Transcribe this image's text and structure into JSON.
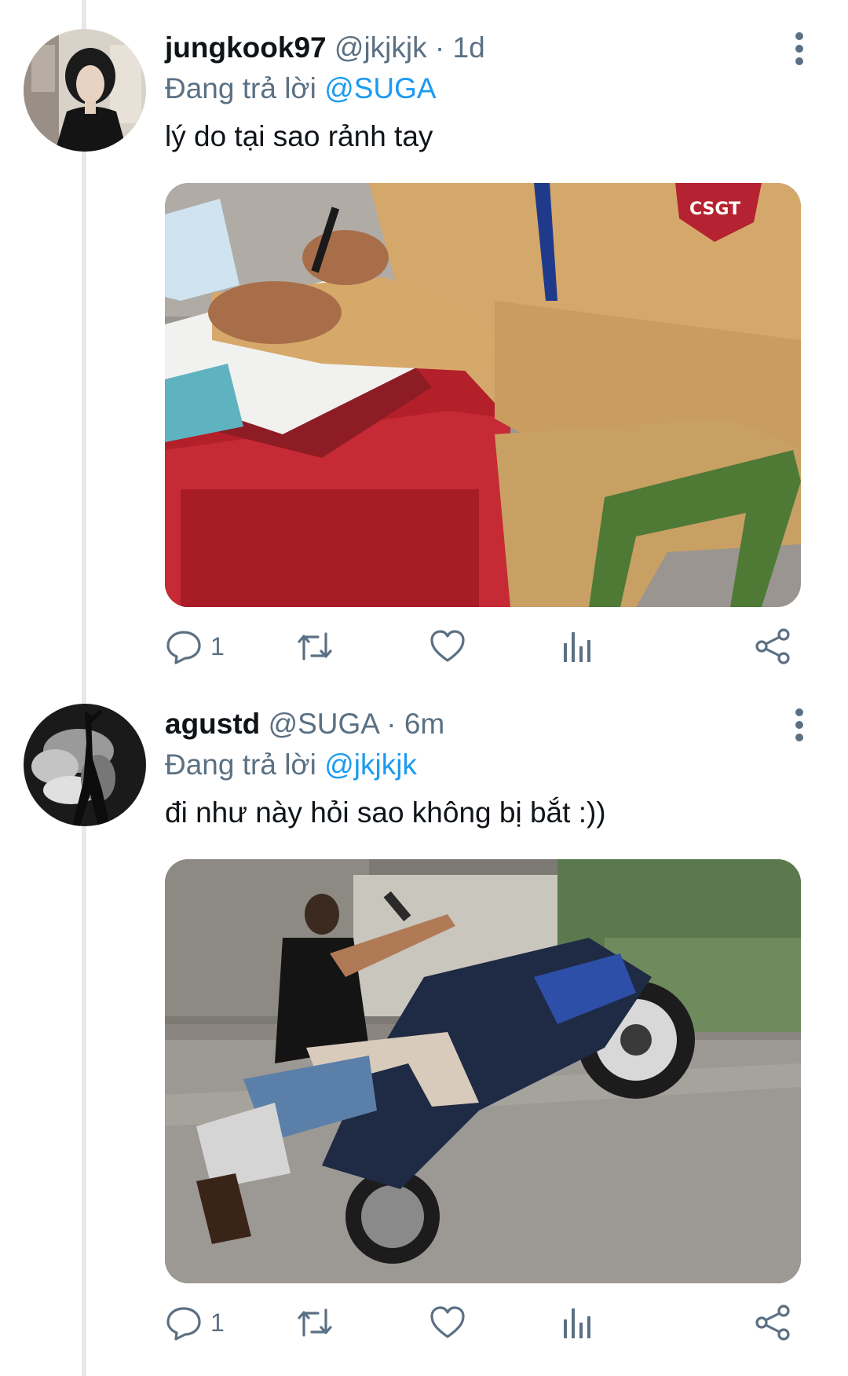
{
  "tweets": [
    {
      "name": "jungkook97",
      "handle": "@jkjkjk",
      "separator": "·",
      "time": "1d",
      "reply_prefix": "Đang trả lời",
      "reply_to": "@SUGA",
      "text": "lý do tại sao rảnh tay",
      "reply_count": "1",
      "media_icon": "photo-traffic-police-writing-ticket",
      "badge_text": "CSGT"
    },
    {
      "name": "agustd",
      "handle": "@SUGA",
      "separator": "·",
      "time": "6m",
      "reply_prefix": "Đang trả lời",
      "reply_to": "@jkjkjk",
      "text": "đi như này hỏi sao không bị bắt :))",
      "reply_count": "1",
      "media_icon": "photo-motorbike-wheelie"
    }
  ],
  "colors": {
    "text": "#0f1419",
    "secondary": "#5b7083",
    "link": "#1d9bf0",
    "thread_line": "#e6e8ea"
  },
  "icons": [
    "more-vertical-icon",
    "reply-icon",
    "retweet-icon",
    "like-icon",
    "analytics-icon",
    "share-icon"
  ]
}
